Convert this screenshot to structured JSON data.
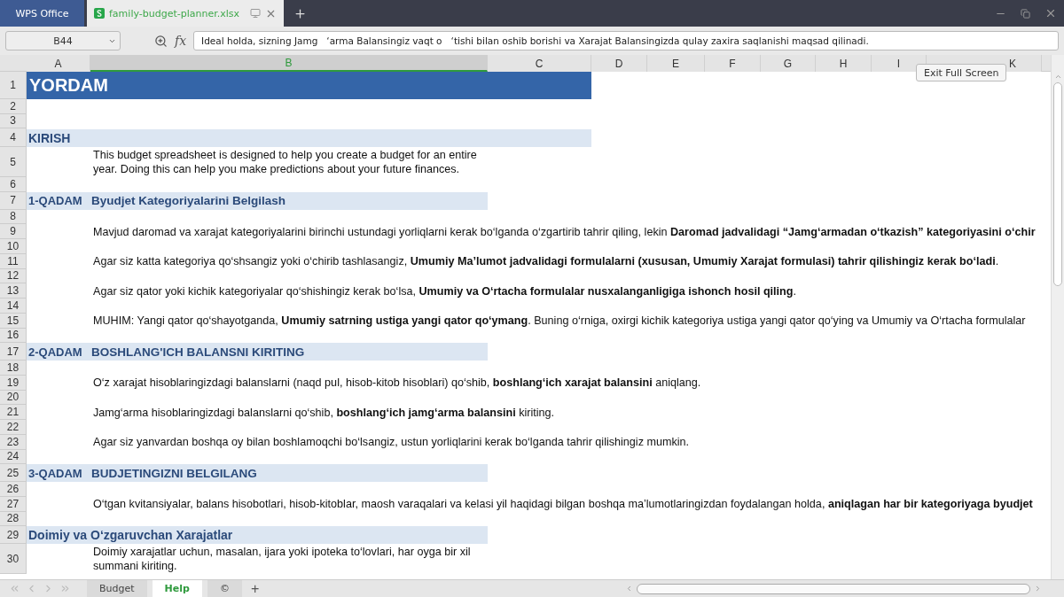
{
  "app_tabs": [
    {
      "kind": "home",
      "label": "WPS Office",
      "selected": false
    },
    {
      "kind": "file",
      "label": "family-budget-planner.xlsx",
      "selected": true
    }
  ],
  "formula_bar": {
    "cell": "B44",
    "fx": "fx",
    "value": "Ideal holda, sizning Jamg   ‘arma Balansingiz vaqt o   ‘tishi bilan oshib borishi va Xarajat Balansingizda qulay zaxira saqlanishi maqsad qilinadi."
  },
  "columns": [
    {
      "label": "A",
      "selected": false
    },
    {
      "label": "B",
      "selected": true
    },
    {
      "label": "C",
      "selected": false
    },
    {
      "label": "D",
      "selected": false
    },
    {
      "label": "E",
      "selected": false
    },
    {
      "label": "F",
      "selected": false
    },
    {
      "label": "G",
      "selected": false
    },
    {
      "label": "H",
      "selected": false
    },
    {
      "label": "I",
      "selected": false
    },
    {
      "label": "K",
      "selected": false
    }
  ],
  "tooltip": "Exit Full Screen",
  "rows": [
    {
      "number": "1",
      "kind": "title",
      "text": "YORDAM"
    },
    {
      "number": "2",
      "kind": "blank"
    },
    {
      "number": "3",
      "kind": "blank"
    },
    {
      "number": "4",
      "kind": "section",
      "text": "KIRISH"
    },
    {
      "number": "5",
      "kind": "para",
      "text": "This budget spreadsheet is designed to help you create a budget for an entire year. Doing this can help you make predictions about your future finances."
    },
    {
      "number": "6",
      "kind": "blank"
    },
    {
      "number": "7",
      "kind": "step",
      "step": "1-QADAM",
      "text": "Byudjet Kategoriyalarini Belgilash"
    },
    {
      "number": "8",
      "kind": "blank"
    },
    {
      "number": "9",
      "kind": "text",
      "text": "Mavjud daromad va xarajat kategoriyalarini birinchi ustundagi yorliqlarni kerak bo‘lganda o‘zgartirib tahrir qiling, lekin **Daromad jadvalidagi “Jamg‘armadan o‘tkazish” kategoriyasini o‘chir**"
    },
    {
      "number": "10",
      "kind": "blank"
    },
    {
      "number": "11",
      "kind": "text",
      "text": "Agar siz katta kategoriya qo‘shsangiz yoki o‘chirib tashlasangiz, **Umumiy Ma’lumot jadvalidagi formulalarni (xususan, Umumiy Xarajat formulasi) tahrir qilishingiz kerak bo‘ladi**."
    },
    {
      "number": "12",
      "kind": "blank"
    },
    {
      "number": "13",
      "kind": "text",
      "text": "Agar siz qator yoki kichik kategoriyalar qo‘shishingiz kerak bo‘lsa, **Umumiy va O‘rtacha formulalar nusxalanganligiga ishonch hosil qiling**."
    },
    {
      "number": "14",
      "kind": "blank"
    },
    {
      "number": "15",
      "kind": "text",
      "text": "MUHIM: Yangi qator qo‘shayotganda, **Umumiy satrning ustiga yangi qator qo‘ymang**. Buning o‘rniga, oxirgi kichik kategoriya ustiga yangi qator qo‘ying va Umumiy va O‘rtacha formulalar"
    },
    {
      "number": "16",
      "kind": "blank"
    },
    {
      "number": "17",
      "kind": "step",
      "step": "2-QADAM",
      "text": "BOSHLANG'ICH BALANSNI KIRITING"
    },
    {
      "number": "18",
      "kind": "blank"
    },
    {
      "number": "19",
      "kind": "text",
      "text": "O‘z xarajat hisoblaringizdagi balanslarni (naqd pul, hisob-kitob hisoblari) qo‘shib, **boshlang‘ich xarajat balansini** aniqlang."
    },
    {
      "number": "20",
      "kind": "blank"
    },
    {
      "number": "21",
      "kind": "text",
      "text": "Jamg‘arma hisoblaringizdagi balanslarni qo‘shib, **boshlang‘ich jamg‘arma balansini** kiriting."
    },
    {
      "number": "22",
      "kind": "blank"
    },
    {
      "number": "23",
      "kind": "text",
      "text": "Agar siz yanvardan boshqa oy bilan boshlamoqchi bo‘lsangiz, ustun yorliqlarini kerak bo‘lganda tahrir qilishingiz mumkin."
    },
    {
      "number": "24",
      "kind": "blank"
    },
    {
      "number": "25",
      "kind": "step",
      "step": "3-QADAM",
      "text": "BUDJETINGIZNI BELGILANG"
    },
    {
      "number": "26",
      "kind": "blank"
    },
    {
      "number": "27",
      "kind": "text",
      "text": "O‘tgan kvitansiyalar, balans hisobotlari, hisob-kitoblar, maosh varaqalari va kelasi yil haqidagi bilgan boshqa ma’lumotlaringizdan foydalangan holda, **aniqlagan har bir kategoriyaga byudjet**"
    },
    {
      "number": "28",
      "kind": "blank"
    },
    {
      "number": "29",
      "kind": "subsection",
      "text": "Doimiy va O‘zgaruvchan Xarajatlar"
    },
    {
      "number": "30",
      "kind": "para",
      "text": "Doimiy xarajatlar uchun, masalan, ijara yoki ipoteka to‘lovlari, har oyga bir xil summani kiriting."
    }
  ],
  "sheet_tabs": [
    {
      "kind": "sheet",
      "label": "Budget",
      "selected": false
    },
    {
      "kind": "sheet",
      "label": "Help",
      "selected": true
    },
    {
      "kind": "sheet",
      "label": "©",
      "selected": false
    }
  ],
  "add_sheet": "+"
}
